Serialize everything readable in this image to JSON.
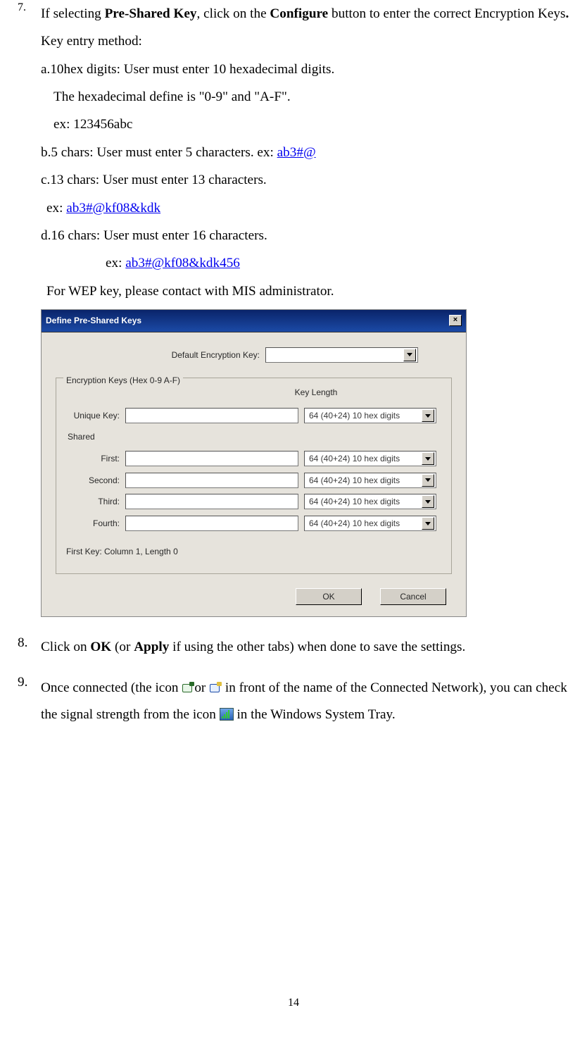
{
  "doc": {
    "item7_num": "7.",
    "item7_prefix": "If selecting ",
    "item7_b1": "Pre-Shared Key",
    "item7_mid": ", click on the ",
    "item7_b2": "Configure",
    "item7_suffix": " button to enter the correct Encryption Keys",
    "item7_dot": ".",
    "key_entry": "Key entry method:",
    "a_line": "a.10hex digits: User must enter 10 hexadecimal digits.",
    "a_sub1": "The hexadecimal define is \"0-9\" and \"A-F\".",
    "a_sub2": "ex: 123456abc",
    "b_prefix": "b.5 chars: User must enter 5 characters. ex: ",
    "b_link": "ab3#@",
    "c_line": "c.13 chars: User must enter 13 characters.",
    "c_sub_prefix": "ex: ",
    "c_sub_link": "ab3#@kf08&kdk",
    "d_line": "d.16 chars: User must enter 16 characters.",
    "d_sub_prefix": "ex: ",
    "d_sub_link": "ab3#@kf08&kdk456",
    "wep": "For WEP key, please contact with MIS administrator.",
    "item8_num": "8.",
    "item8_p1": "Click on ",
    "item8_b1": "OK",
    "item8_p2": " (or ",
    "item8_b2": "Apply",
    "item8_p3": " if using the other tabs) when done to save the settings.",
    "item9_num": "9.",
    "item9_p1": "Once connected (the icon ",
    "item9_p2": "or ",
    "item9_p3": " in front of the name of the Connected Network), you can check the signal strength from the icon ",
    "item9_p4": " in the Windows System Tray.",
    "page_number": "14"
  },
  "dialog": {
    "title": "Define Pre-Shared Keys",
    "default_key_label": "Default Encryption Key:",
    "default_key_value": "",
    "group_title": "Encryption Keys (Hex 0-9 A-F)",
    "key_length_header": "Key Length",
    "unique_label": "Unique Key:",
    "unique_value": "",
    "unique_combo": "64  (40+24)  10 hex digits",
    "shared_label": "Shared",
    "first_label": "First:",
    "first_value": "",
    "first_combo": "64  (40+24)  10 hex digits",
    "second_label": "Second:",
    "second_value": "",
    "second_combo": "64  (40+24)  10 hex digits",
    "third_label": "Third:",
    "third_value": "",
    "third_combo": "64  (40+24)  10 hex digits",
    "fourth_label": "Fourth:",
    "fourth_value": "",
    "fourth_combo": "64  (40+24)  10 hex digits",
    "status_text": "First Key: Column 1,  Length 0",
    "ok_button": "OK",
    "cancel_button": "Cancel"
  }
}
